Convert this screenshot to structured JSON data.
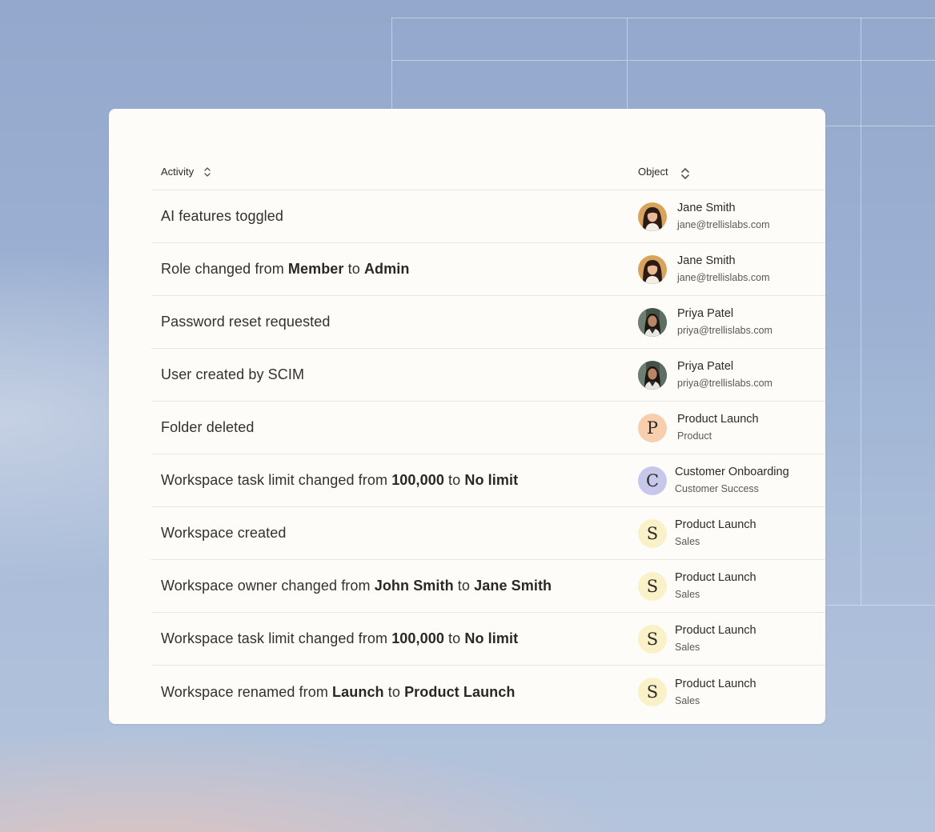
{
  "header": {
    "activity_label": "Activity",
    "object_label": "Object"
  },
  "rows": [
    {
      "activity": [
        {
          "t": "AI features toggled",
          "b": false
        }
      ],
      "object": {
        "title": "Jane Smith",
        "subtitle": "jane@trellislabs.com",
        "avatar": "photo-jane"
      }
    },
    {
      "activity": [
        {
          "t": "Role changed from ",
          "b": false
        },
        {
          "t": "Member",
          "b": true
        },
        {
          "t": " to ",
          "b": false
        },
        {
          "t": "Admin",
          "b": true
        }
      ],
      "object": {
        "title": "Jane Smith",
        "subtitle": "jane@trellislabs.com",
        "avatar": "photo-jane"
      }
    },
    {
      "activity": [
        {
          "t": "Password reset requested",
          "b": false
        }
      ],
      "object": {
        "title": "Priya Patel",
        "subtitle": "priya@trellislabs.com",
        "avatar": "photo-priya"
      }
    },
    {
      "activity": [
        {
          "t": "User created by SCIM",
          "b": false
        }
      ],
      "object": {
        "title": "Priya Patel",
        "subtitle": "priya@trellislabs.com",
        "avatar": "photo-priya"
      }
    },
    {
      "activity": [
        {
          "t": "Folder deleted",
          "b": false
        }
      ],
      "object": {
        "title": "Product Launch",
        "subtitle": "Product",
        "avatar": "letter",
        "letter": "P",
        "color": "#f7cfae"
      }
    },
    {
      "activity": [
        {
          "t": "Workspace task limit changed from ",
          "b": false
        },
        {
          "t": "100,000",
          "b": true
        },
        {
          "t": " to ",
          "b": false
        },
        {
          "t": "No limit",
          "b": true
        }
      ],
      "object": {
        "title": "Customer Onboarding",
        "subtitle": "Customer Success",
        "avatar": "letter",
        "letter": "C",
        "color": "#c7c7ec"
      }
    },
    {
      "activity": [
        {
          "t": "Workspace created",
          "b": false
        }
      ],
      "object": {
        "title": "Product Launch",
        "subtitle": "Sales",
        "avatar": "letter",
        "letter": "S",
        "color": "#fbf1c8"
      }
    },
    {
      "activity": [
        {
          "t": "Workspace owner changed from ",
          "b": false
        },
        {
          "t": "John Smith",
          "b": true
        },
        {
          "t": " to ",
          "b": false
        },
        {
          "t": "Jane Smith",
          "b": true
        }
      ],
      "object": {
        "title": "Product Launch",
        "subtitle": "Sales",
        "avatar": "letter",
        "letter": "S",
        "color": "#fbf1c8"
      }
    },
    {
      "activity": [
        {
          "t": "Workspace task limit changed from ",
          "b": false
        },
        {
          "t": "100,000",
          "b": true
        },
        {
          "t": " to ",
          "b": false
        },
        {
          "t": "No limit",
          "b": true
        }
      ],
      "object": {
        "title": "Product Launch",
        "subtitle": "Sales",
        "avatar": "letter",
        "letter": "S",
        "color": "#fbf1c8"
      }
    },
    {
      "activity": [
        {
          "t": "Workspace renamed from ",
          "b": false
        },
        {
          "t": "Launch",
          "b": true
        },
        {
          "t": " to ",
          "b": false
        },
        {
          "t": "Product Launch",
          "b": true
        }
      ],
      "object": {
        "title": "Product Launch",
        "subtitle": "Sales",
        "avatar": "letter",
        "letter": "S",
        "color": "#fbf1c8"
      }
    }
  ]
}
